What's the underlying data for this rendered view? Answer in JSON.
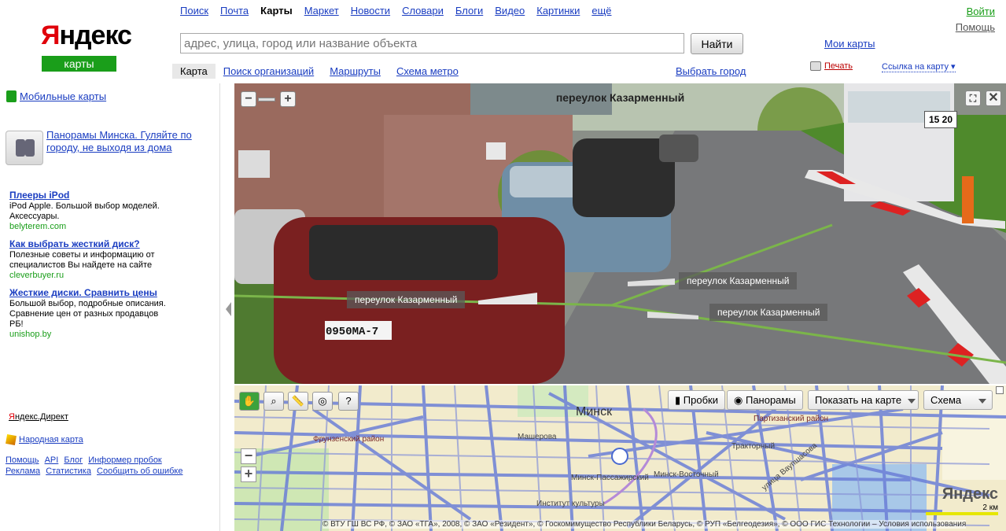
{
  "logo": {
    "brand_first": "Я",
    "brand_rest": "ндекс",
    "service": "карты"
  },
  "topnav": [
    "Поиск",
    "Почта",
    "Карты",
    "Маркет",
    "Новости",
    "Словари",
    "Блоги",
    "Видео",
    "Картинки",
    "ещё"
  ],
  "topnav_current": "Карты",
  "header": {
    "login": "Войти",
    "help": "Помощь",
    "my_maps": "Мои карты",
    "choose_city": "Выбрать город",
    "print": "Печать",
    "map_link": "Ссылка на карту ▾"
  },
  "search": {
    "placeholder": "адрес, улица, город или название объекта",
    "button": "Найти"
  },
  "subnav": [
    "Карта",
    "Поиск организаций",
    "Маршруты",
    "Схема метро"
  ],
  "sidebar": {
    "mobile_maps": "Мобильные карты",
    "panorama_promo": "Панорамы Минска. Гуляйте по городу, не выходя из дома",
    "ads": [
      {
        "title": "Плееры iPod",
        "text": "iPod Apple. Большой выбор моделей. Аксессуары.",
        "url": "belyterem.com"
      },
      {
        "title": "Как выбрать жесткий диск?",
        "text": "Полезные советы и информацию от специалистов Вы найдете на сайте",
        "url": "cleverbuyer.ru"
      },
      {
        "title": "Жесткие диски. Сравнить цены",
        "text": "Большой выбор, подробные описания. Сравнение цен от разных продавцов РБ!",
        "url": "unishop.by"
      }
    ],
    "direct_first": "Я",
    "direct_rest": "ндекс.Директ",
    "people_map": "Народная карта",
    "footer_links": [
      "Помощь",
      "API",
      "Блог",
      "Информер пробок",
      "Реклама",
      "Статистика",
      "Сообщить об ошибке"
    ]
  },
  "panorama": {
    "street_title": "переулок Казарменный",
    "labels": [
      "переулок Казарменный",
      "переулок Казарменный",
      "переулок Казарменный"
    ],
    "plate": "0950МА-7",
    "sign": "15 20"
  },
  "map": {
    "buttons": {
      "traffic": "Пробки",
      "panoramas": "Панорамы",
      "show_on_map": "Показать на карте",
      "scheme": "Схема"
    },
    "labels": {
      "city": "Минск",
      "district1": "Фрунзенский район",
      "district2": "Партизанский район",
      "street1": "Тракторный",
      "street2": "улица Ваупшасова",
      "street3": "Машерова",
      "street4": "Минск-Пассажирский",
      "street5": "Минск-Восточный",
      "street6": "Институт культуры"
    },
    "copyright": "© ВТУ ГШ ВС РФ, © ЗАО «ТГА», 2008, © ЗАО «Резидент», © Госкомимущество Республики Беларусь, © РУП «Белгеодезия», © ООО ГИС Технологии – Условия использования",
    "scale_brand": "Яндекс",
    "scale_label": "2 км"
  },
  "colors": {
    "brand_green": "#1a9e1a",
    "brand_red": "#e0000a",
    "link": "#1a3dc1",
    "road": "#6b7fd7"
  }
}
